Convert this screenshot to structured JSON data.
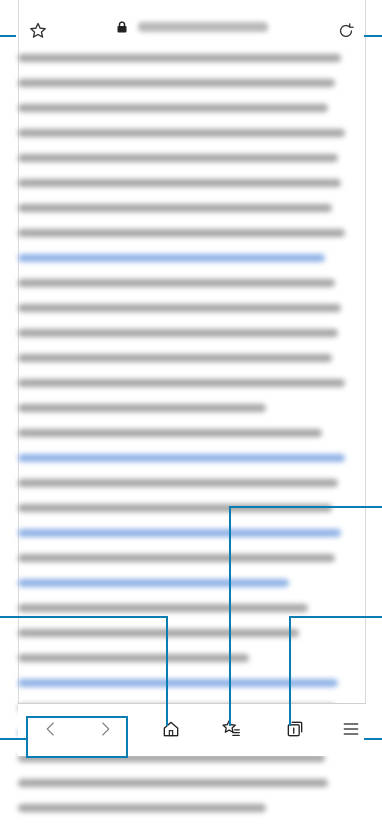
{
  "address_bar": {
    "url": "",
    "secure": true
  },
  "content": {
    "paragraphs": [
      {
        "lines": 15
      },
      {
        "lines": 19
      }
    ]
  },
  "toolbar": {
    "buttons": [
      "back",
      "forward",
      "home",
      "bookmarks",
      "tabs",
      "menu"
    ]
  },
  "icons": {
    "star": "star-icon",
    "lock": "lock-icon",
    "refresh": "refresh-icon",
    "back": "chevron-left-icon",
    "forward": "chevron-right-icon",
    "home": "home-icon",
    "bookmarks": "bookmarks-icon",
    "tabs": "tabs-icon",
    "menu": "menu-icon"
  },
  "colors": {
    "callout": "#0a7db5",
    "link_text": "#8fb2e6",
    "body_text": "#a5a5a5"
  }
}
